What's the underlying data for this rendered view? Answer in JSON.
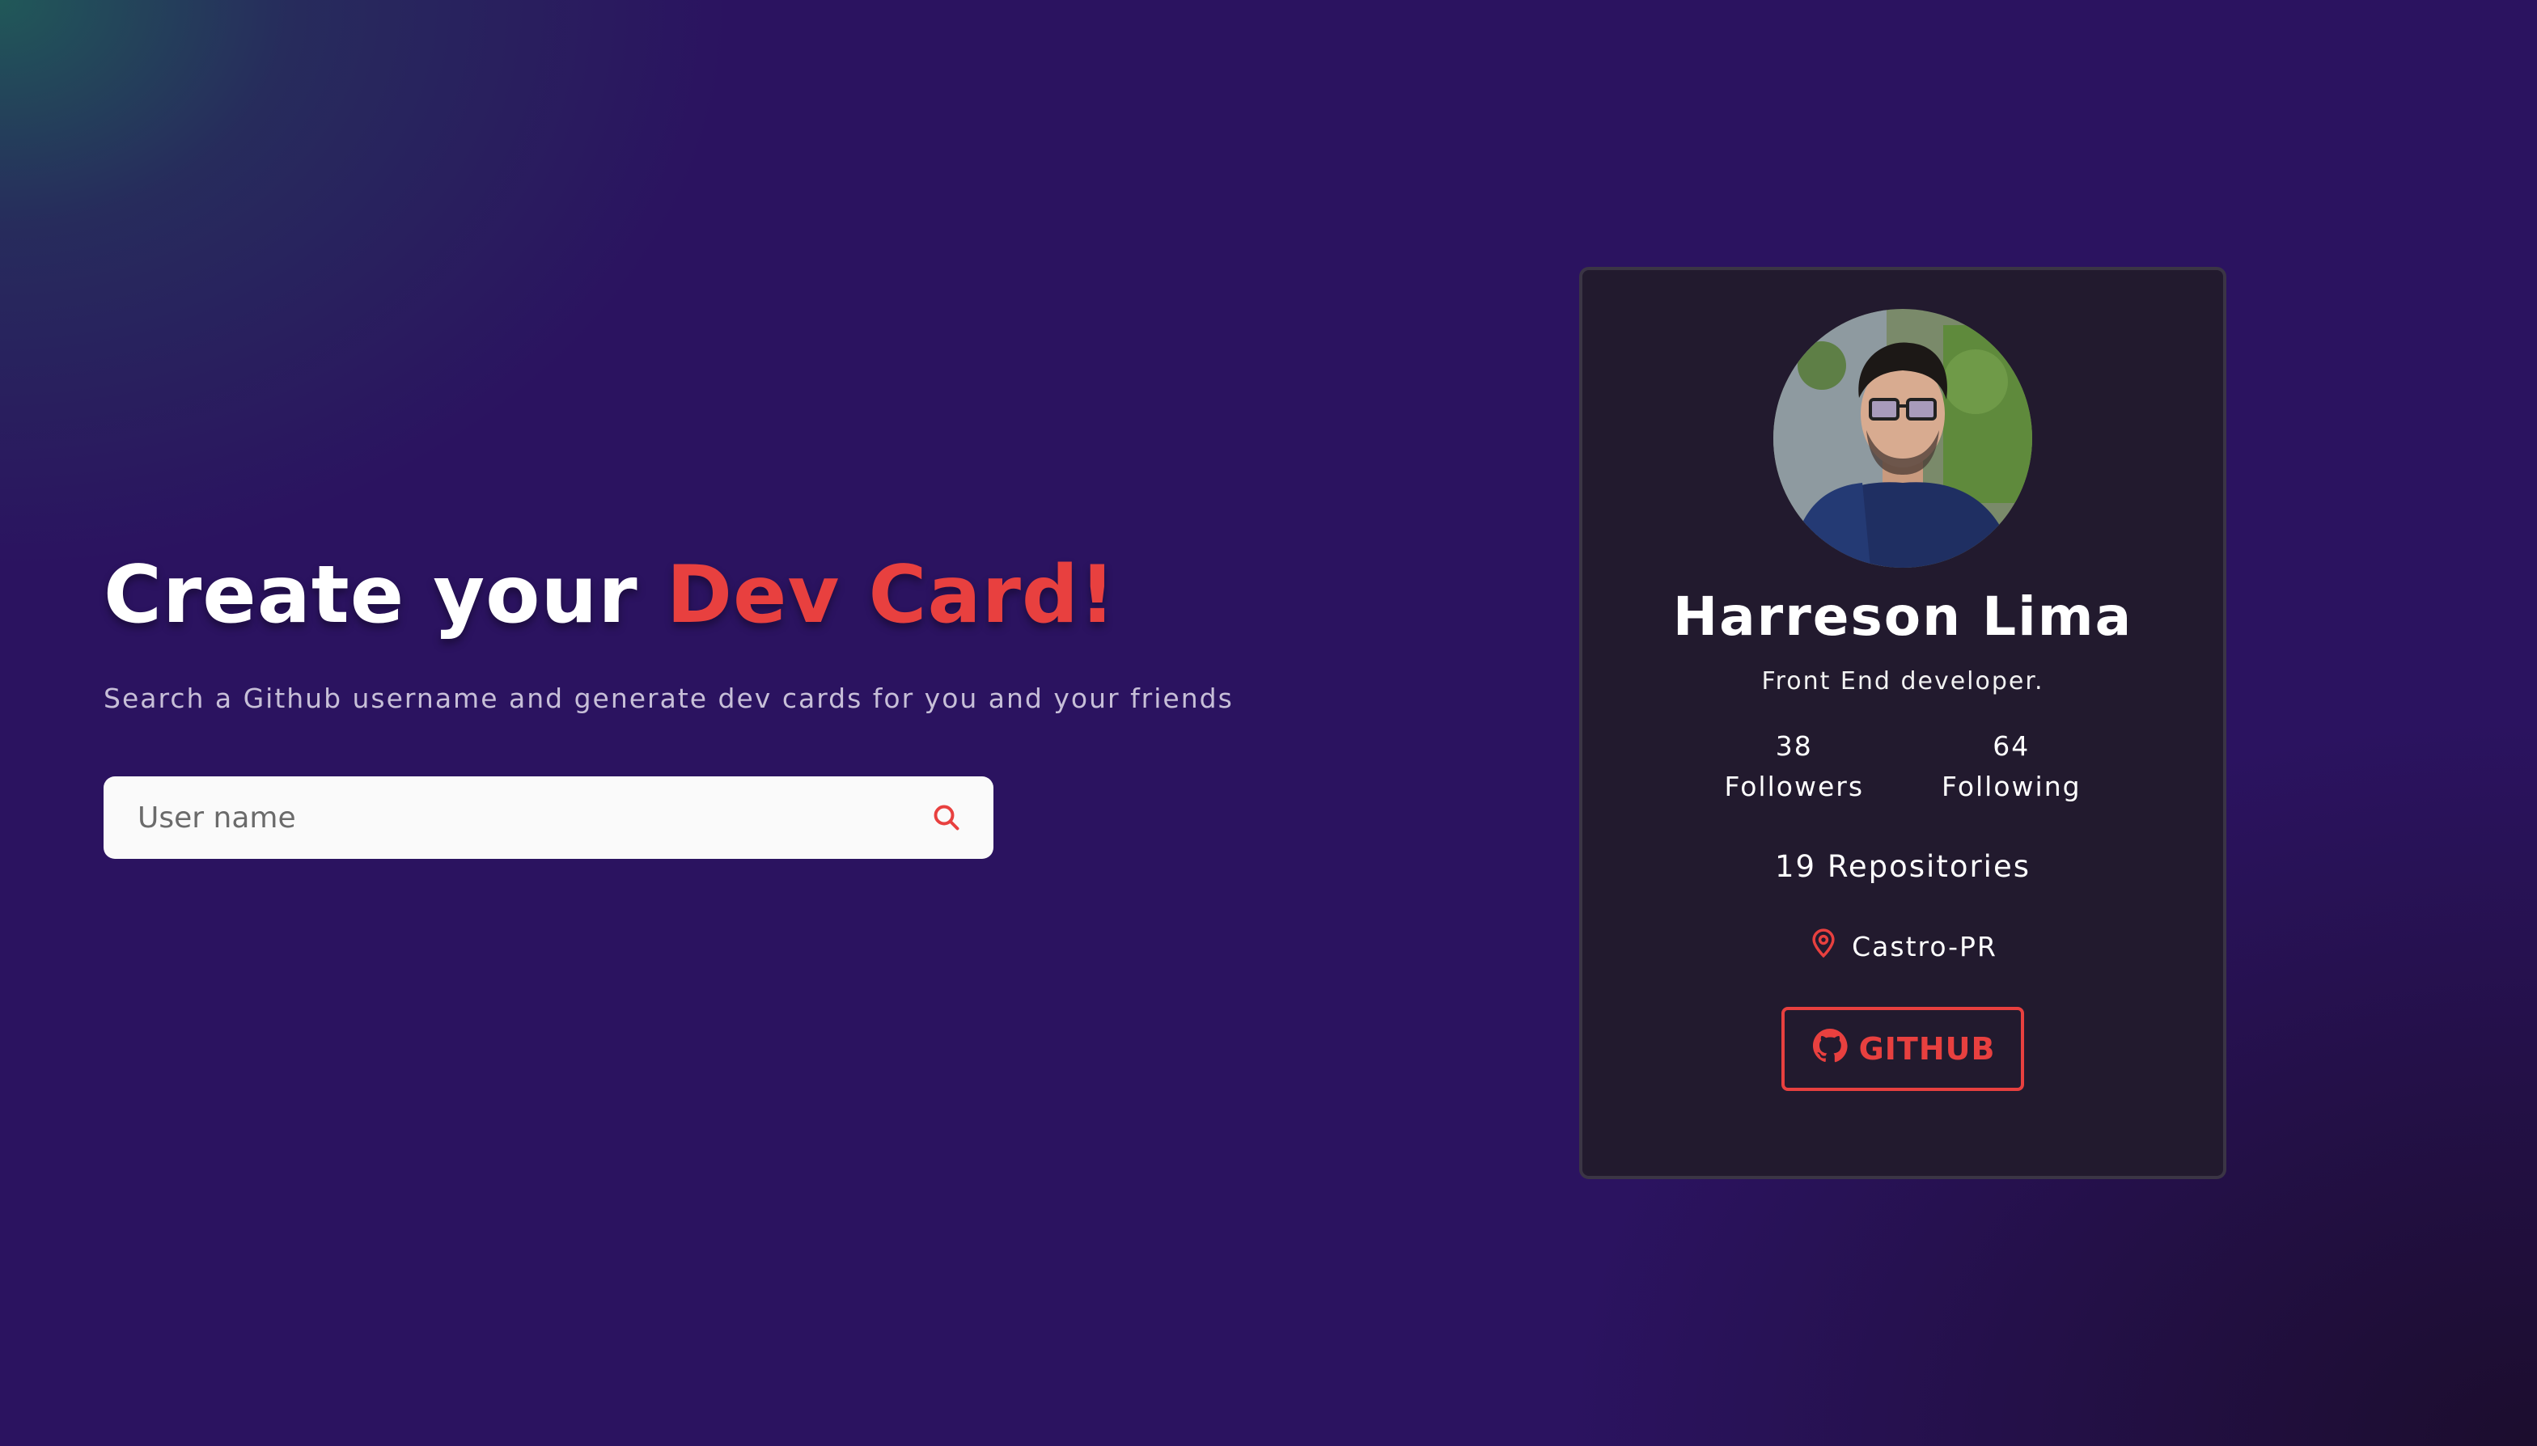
{
  "hero": {
    "title_plain": "Create your ",
    "title_accent": "Dev Card!",
    "subtitle": "Search a Github username and generate dev cards for you and your friends"
  },
  "search": {
    "placeholder": "User name",
    "value": "",
    "icon": "search-icon"
  },
  "card": {
    "name": "Harreson Lima",
    "bio": "Front End developer.",
    "followers_count": "38",
    "followers_label": "Followers",
    "following_count": "64",
    "following_label": "Following",
    "repositories": "19 Repositories",
    "location": "Castro-PR",
    "location_icon": "map-pin-icon",
    "github_label": "GITHUB",
    "github_icon": "github-icon",
    "avatar_icon": "avatar"
  },
  "colors": {
    "accent": "#e8403f",
    "background": "#2b1360",
    "card": "#221a2e"
  }
}
